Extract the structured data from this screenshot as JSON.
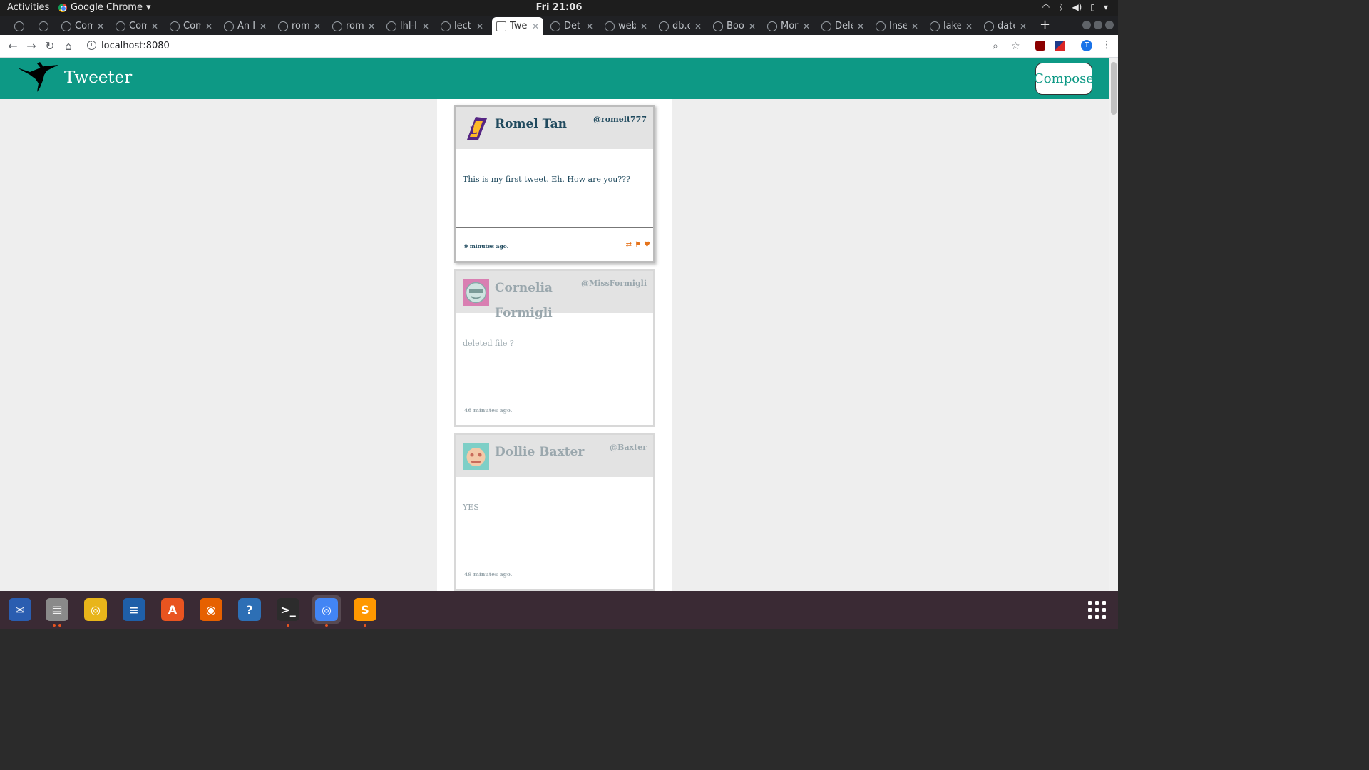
{
  "topbar": {
    "activities": "Activities",
    "app_name": "Google Chrome",
    "clock": "Fri 21:06"
  },
  "browser": {
    "tabs": [
      {
        "title": "",
        "active": false
      },
      {
        "title": "",
        "active": false
      },
      {
        "title": "Com",
        "active": false
      },
      {
        "title": "Com",
        "active": false
      },
      {
        "title": "Com",
        "active": false
      },
      {
        "title": "An I",
        "active": false
      },
      {
        "title": "rom",
        "active": false
      },
      {
        "title": "rom",
        "active": false
      },
      {
        "title": "lhl-l",
        "active": false
      },
      {
        "title": "lect",
        "active": false
      },
      {
        "title": "Twe",
        "active": true
      },
      {
        "title": "Det",
        "active": false
      },
      {
        "title": "web",
        "active": false
      },
      {
        "title": "db.c",
        "active": false
      },
      {
        "title": "Boo",
        "active": false
      },
      {
        "title": "Mor",
        "active": false
      },
      {
        "title": "Dele",
        "active": false
      },
      {
        "title": "Inse",
        "active": false
      },
      {
        "title": "lake",
        "active": false
      },
      {
        "title": "date",
        "active": false
      }
    ],
    "url": "localhost:8080",
    "profile_initial": "T"
  },
  "app": {
    "brand": "Tweeter",
    "compose_label": "Compose",
    "brand_color": "#0d9985",
    "text_color": "#204a5e",
    "icon_color": "#e5731b"
  },
  "tweets": [
    {
      "name": "Romel Tan",
      "handle": "@romelt777",
      "content": "This is my first tweet. Eh. How are you???",
      "time": "9 minutes ago.",
      "avatar": "lakers-logo-avatar",
      "hovered": true
    },
    {
      "name": "Cornelia Formigli",
      "handle": "@MissFormigli",
      "content": "deleted file ?",
      "time": "46 minutes ago.",
      "avatar": "pink-robot-avatar",
      "hovered": false
    },
    {
      "name": "Dollie Baxter",
      "handle": "@Baxter",
      "content": "YES",
      "time": "49 minutes ago.",
      "avatar": "teal-robot-avatar",
      "hovered": false
    }
  ],
  "tweet_icons": [
    "retweet-icon",
    "flag-icon",
    "heart-icon"
  ],
  "dock": [
    "thunderbird",
    "files",
    "rhythmbox",
    "writer",
    "software",
    "firefox",
    "help",
    "terminal",
    "chrome",
    "sublime"
  ]
}
